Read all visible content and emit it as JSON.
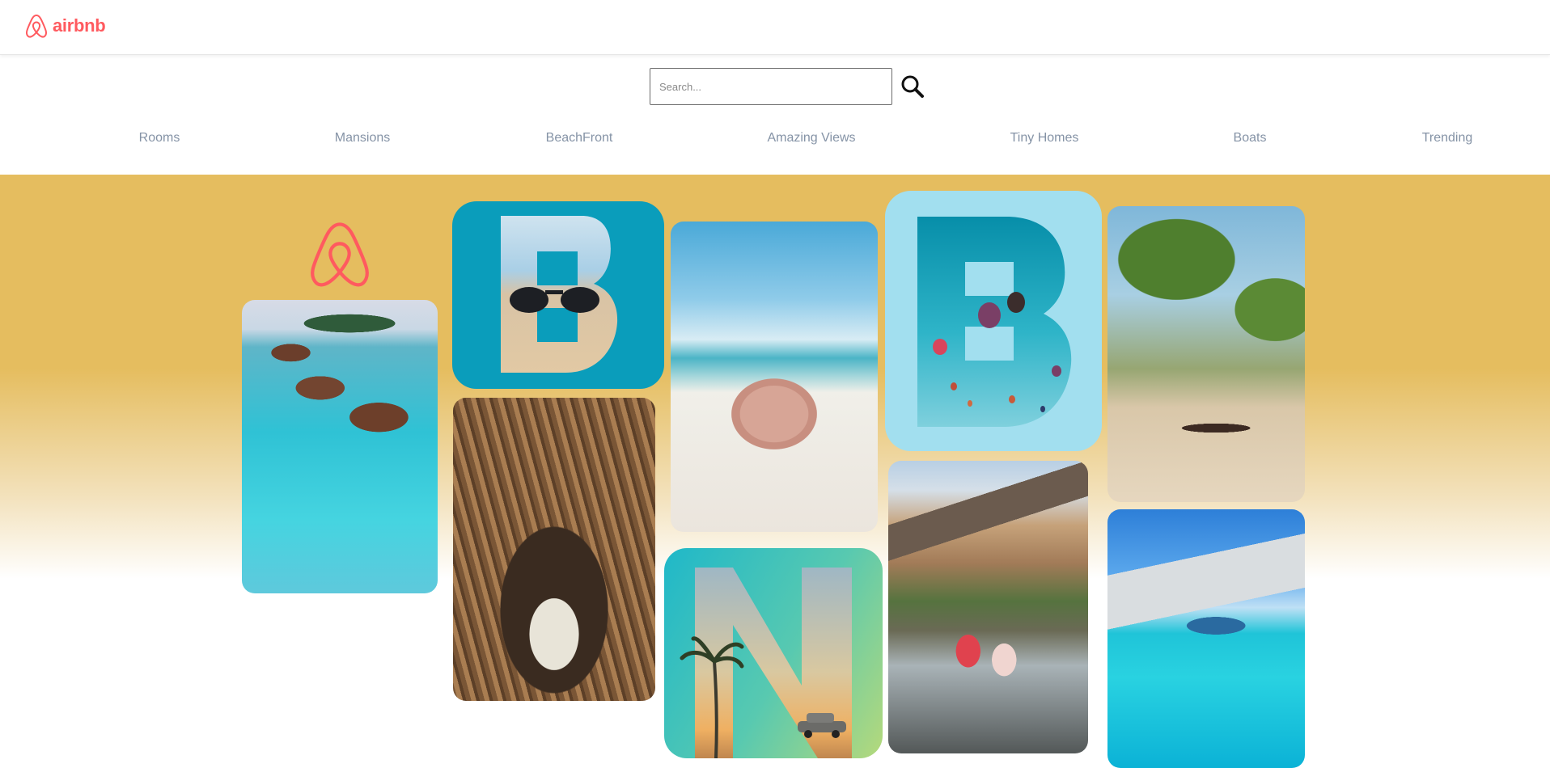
{
  "header": {
    "brand_name": "airbnb",
    "brand_color": "#ff5a5f"
  },
  "search": {
    "placeholder": "Search...",
    "value": "",
    "button_icon": "search-icon"
  },
  "categories": [
    {
      "label": "Rooms"
    },
    {
      "label": "Mansions"
    },
    {
      "label": "BeachFront"
    },
    {
      "label": "Amazing Views"
    },
    {
      "label": "Tiny Homes"
    },
    {
      "label": "Boats"
    },
    {
      "label": "Trending"
    }
  ],
  "hero": {
    "background_color": "#e5bd5f",
    "tiles": [
      {
        "name": "overwater-villas-image"
      },
      {
        "name": "letter-b-sunglasses-tile",
        "letter": "B"
      },
      {
        "name": "bamboo-tunnel-image"
      },
      {
        "name": "beach-hat-image"
      },
      {
        "name": "letter-b-balloons-tile",
        "letter": "B"
      },
      {
        "name": "letter-n-palm-car-tile",
        "letter": "N"
      },
      {
        "name": "yosemite-river-image"
      },
      {
        "name": "palm-beach-loungers-image"
      },
      {
        "name": "pool-umbrella-image"
      }
    ]
  }
}
